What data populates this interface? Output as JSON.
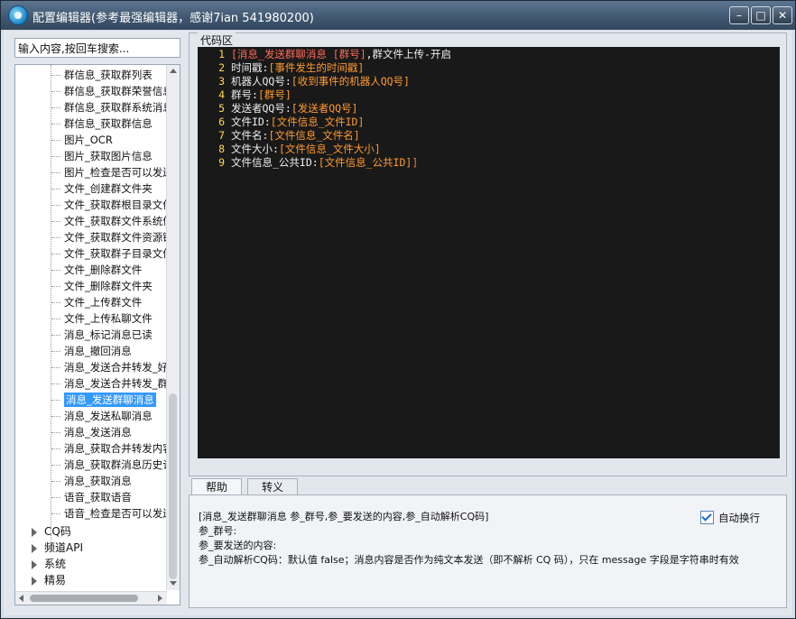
{
  "window": {
    "title": "配置编辑器(参考最强编辑器，感谢7ian 541980200)",
    "buttons": {
      "minimize": "–",
      "maximize": "□",
      "close": "✕"
    }
  },
  "search": {
    "placeholder": "输入内容,按回车搜索..."
  },
  "tree": {
    "children": [
      "群信息_获取群列表",
      "群信息_获取群荣誉信息",
      "群信息_获取群系统消息",
      "群信息_获取群信息",
      "图片_OCR",
      "图片_获取图片信息",
      "图片_检查是否可以发送图片",
      "文件_创建群文件夹",
      "文件_获取群根目录文件",
      "文件_获取群文件系统信息",
      "文件_获取群文件资源链接",
      "文件_获取群子目录文件",
      "文件_删除群文件",
      "文件_删除群文件夹",
      "文件_上传群文件",
      "文件_上传私聊文件",
      "消息_标记消息已读",
      "消息_撤回消息",
      "消息_发送合并转发_好友",
      "消息_发送合并转发_群",
      "消息_发送群聊消息",
      "消息_发送私聊消息",
      "消息_发送消息",
      "消息_获取合并转发内容",
      "消息_获取群消息历史记录",
      "消息_获取消息",
      "语音_获取语音",
      "语音_检查是否可以发送语音"
    ],
    "selected": "消息_发送群聊消息",
    "top_level": [
      "CQ码",
      "频道API",
      "系统",
      "精易"
    ]
  },
  "code_area": {
    "label": "代码区",
    "lines": [
      {
        "n": "1",
        "parts": [
          [
            "b",
            "[消息_发送群聊消息 [群号]"
          ],
          [
            "w",
            ",群文件上传-开启"
          ]
        ]
      },
      {
        "n": "2",
        "parts": [
          [
            "w",
            "时间戳:"
          ],
          [
            "o",
            "[事件发生的时间戳]"
          ]
        ]
      },
      {
        "n": "3",
        "parts": [
          [
            "w",
            "机器人QQ号:"
          ],
          [
            "o",
            "[收到事件的机器人QQ号]"
          ]
        ]
      },
      {
        "n": "4",
        "parts": [
          [
            "w",
            "群号:"
          ],
          [
            "o",
            "[群号]"
          ]
        ]
      },
      {
        "n": "5",
        "parts": [
          [
            "w",
            "发送者QQ号:"
          ],
          [
            "o",
            "[发送者QQ号]"
          ]
        ]
      },
      {
        "n": "6",
        "parts": [
          [
            "w",
            "文件ID:"
          ],
          [
            "o",
            "[文件信息_文件ID]"
          ]
        ]
      },
      {
        "n": "7",
        "parts": [
          [
            "w",
            "文件名:"
          ],
          [
            "o",
            "[文件信息_文件名]"
          ]
        ]
      },
      {
        "n": "8",
        "parts": [
          [
            "w",
            "文件大小:"
          ],
          [
            "o",
            "[文件信息_文件大小]"
          ]
        ]
      },
      {
        "n": "9",
        "parts": [
          [
            "w",
            "文件信息_公共ID:"
          ],
          [
            "o",
            "[文件信息_公共ID]"
          ],
          [
            "b",
            "]"
          ]
        ]
      }
    ]
  },
  "bottom_tabs": [
    "帮助",
    "转义"
  ],
  "help": {
    "lines": [
      "[消息_发送群聊消息 参_群号,参_要发送的内容,参_自动解析CQ码]",
      "参_群号:",
      "参_要发送的内容:",
      "参_自动解析CQ码：默认值 false；消息内容是否作为纯文本发送（即不解析 CQ 码），只在 message 字段是字符串时有效"
    ],
    "auto_wrap_label": "自动换行",
    "auto_wrap_checked": true
  },
  "colors": {
    "code_bg": "#191919",
    "line_number": "#ffd84a",
    "bracket_red": "#ff6b5a",
    "bracket_orange": "#ff9a2e",
    "selection": "#3399ff"
  }
}
